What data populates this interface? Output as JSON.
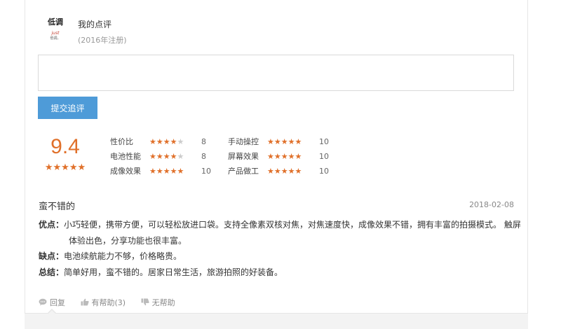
{
  "user": {
    "avatar_text": "低调",
    "avatar_sub_red": "just",
    "avatar_sub_small": "低调。",
    "title": "我的点评",
    "registered": "(2016年注册)"
  },
  "composer": {
    "placeholder": "",
    "submit_label": "提交追评"
  },
  "score": {
    "value": "9.4",
    "stars": "★★★★★",
    "accent_color": "#e0702a"
  },
  "ratings": [
    {
      "label": "性价比",
      "stars_on": "★★★★",
      "stars_off": "★",
      "value": "8"
    },
    {
      "label": "电池性能",
      "stars_on": "★★★★",
      "stars_off": "★",
      "value": "8"
    },
    {
      "label": "成像效果",
      "stars_on": "★★★★★",
      "stars_off": "",
      "value": "10"
    },
    {
      "label": "手动操控",
      "stars_on": "★★★★★",
      "stars_off": "",
      "value": "10"
    },
    {
      "label": "屏幕效果",
      "stars_on": "★★★★★",
      "stars_off": "",
      "value": "10"
    },
    {
      "label": "产品做工",
      "stars_on": "★★★★★",
      "stars_off": "",
      "value": "10"
    }
  ],
  "review": {
    "headline": "蛮不错的",
    "date": "2018-02-08",
    "pros_key": "优点：",
    "pros_text": "小巧轻便，携带方便，可以轻松放进口袋。支持全像素双核对焦，对焦速度快，成像效果不错，拥有丰富的拍摄模式。 触屏体验出色，分享功能也很丰富。",
    "cons_key": "缺点：",
    "cons_text": "电池续航能力不够，价格略贵。",
    "summary_key": "总结：",
    "summary_text": "简单好用，蛮不错的。居家日常生活，旅游拍照的好装备。"
  },
  "actions": {
    "reply_label": "回复",
    "helpful_label": "有帮助(3)",
    "unhelpful_label": "无帮助",
    "icon_color": "#bbbbbb"
  }
}
